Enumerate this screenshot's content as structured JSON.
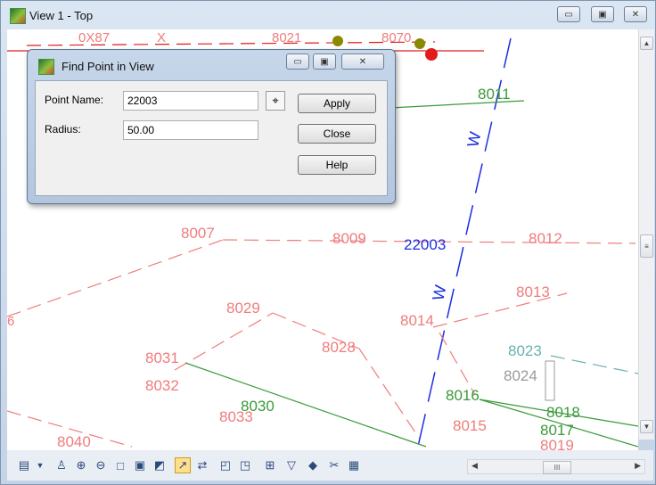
{
  "window": {
    "title": "View 1 - Top"
  },
  "window_buttons": {
    "minimize": "▭",
    "maximize": "▣",
    "close": "✕"
  },
  "dialog": {
    "title": "Find Point in View",
    "point_name_label": "Point Name:",
    "point_name_value": "22003",
    "radius_label": "Radius:",
    "radius_value": "50.00",
    "apply_label": "Apply",
    "close_label": "Close",
    "help_label": "Help"
  },
  "canvas": {
    "point_labels": {
      "p8011": "8011",
      "p8007": "8007",
      "p8009": "8009",
      "p22003": "22003",
      "p8012": "8012",
      "p8013": "8013",
      "p8029": "8029",
      "p8014": "8014",
      "p8028": "8028",
      "p8031": "8031",
      "p8032": "8032",
      "p8023": "8023",
      "p8024": "8024",
      "p8030": "8030",
      "p8033": "8033",
      "p8016": "8016",
      "p8018": "8018",
      "p8017": "8017",
      "p8015": "8015",
      "p8019": "8019",
      "p8040": "8040",
      "p6": "6",
      "top1": "0X87",
      "top2": "X",
      "top3": "8021",
      "top4": "8070",
      "wall1": "W",
      "wall2": "W"
    },
    "colors": {
      "pink": "#f07c7c",
      "green": "#3a9a3a",
      "blue": "#1b2ee0",
      "teal": "#6ab0b0",
      "gray": "#9a9a9a",
      "red": "#e01c1c"
    }
  },
  "scrollbar": {
    "grip": "III"
  },
  "icons": [
    "view-attributes-icon",
    "print-icon",
    "zoom-in-icon",
    "zoom-out-icon",
    "window-area-icon",
    "fit-view-icon",
    "rotate-view-icon",
    "pan-icon",
    "view-previous-icon",
    "view-next-icon",
    "copy-view-icon",
    "fence-icon",
    "render-icon",
    "clip-icon",
    "camera-icon"
  ]
}
